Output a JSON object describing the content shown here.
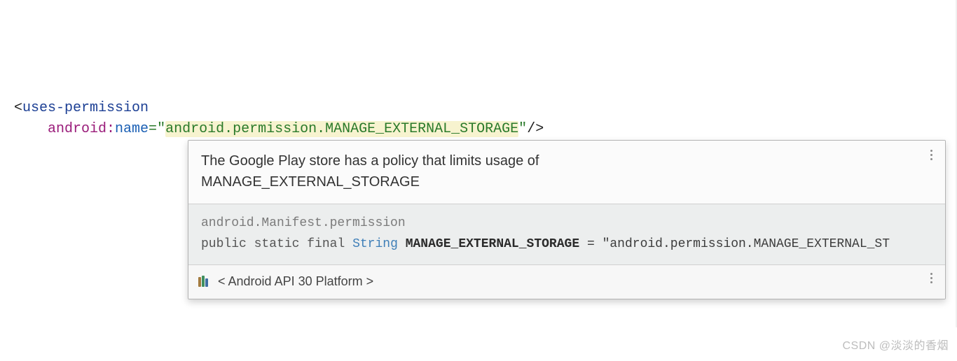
{
  "code": {
    "tag_open_bracket": "<",
    "tag_name": "uses-permission",
    "attr_ns": "android",
    "attr_colon": ":",
    "attr_name": "name",
    "equals": "=",
    "quote": "\"",
    "attr_value": "android.permission.MANAGE_EXTERNAL_STORAGE",
    "tag_close": "/>"
  },
  "popup": {
    "warning_line1": "The Google Play store has a policy that limits usage of",
    "warning_line2": "MANAGE_EXTERNAL_STORAGE",
    "doc": {
      "fqcn": "android.Manifest.permission",
      "kw_public": "public",
      "kw_static": "static",
      "kw_final": "final",
      "type": "String",
      "const_name": "MANAGE_EXTERNAL_STORAGE",
      "eq": " = ",
      "value": "\"android.permission.MANAGE_EXTERNAL_ST"
    },
    "platform_label": "< Android API 30 Platform >"
  },
  "watermark": "CSDN @淡淡的香烟"
}
